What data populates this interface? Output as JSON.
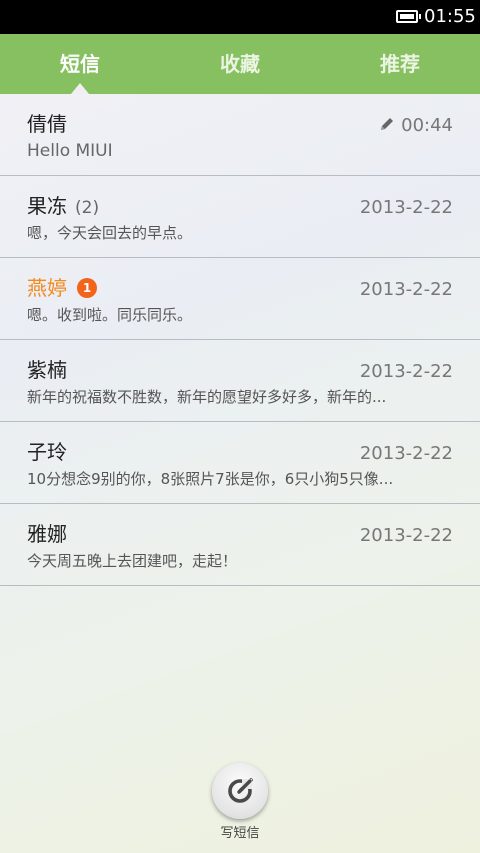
{
  "status_bar": {
    "time": "01:55"
  },
  "tabs": [
    {
      "label": "短信",
      "active": true
    },
    {
      "label": "收藏",
      "active": false
    },
    {
      "label": "推荐",
      "active": false
    }
  ],
  "messages": [
    {
      "name": "倩倩",
      "count": "",
      "badge": "",
      "date": "00:44",
      "draft": true,
      "preview": "Hello MIUI",
      "unread": false
    },
    {
      "name": "果冻",
      "count": "(2)",
      "badge": "",
      "date": "2013-2-22",
      "draft": false,
      "preview": "嗯，今天会回去的早点。",
      "unread": false
    },
    {
      "name": "燕婷",
      "count": "",
      "badge": "1",
      "date": "2013-2-22",
      "draft": false,
      "preview": "嗯。收到啦。同乐同乐。",
      "unread": true
    },
    {
      "name": "紫楠",
      "count": "",
      "badge": "",
      "date": "2013-2-22",
      "draft": false,
      "preview": "新年的祝福数不胜数，新年的愿望好多好多，新年的...",
      "unread": false
    },
    {
      "name": "子玲",
      "count": "",
      "badge": "",
      "date": "2013-2-22",
      "draft": false,
      "preview": "10分想念9别的你，8张照片7张是你，6只小狗5只像...",
      "unread": false
    },
    {
      "name": "雅娜",
      "count": "",
      "badge": "",
      "date": "2013-2-22",
      "draft": false,
      "preview": "今天周五晚上去团建吧，走起！",
      "unread": false
    }
  ],
  "compose": {
    "label": "写短信",
    "icon": "compose-icon"
  },
  "colors": {
    "tab_bar": "#87c061",
    "unread_name": "#f28a1d",
    "badge": "#f26419"
  }
}
